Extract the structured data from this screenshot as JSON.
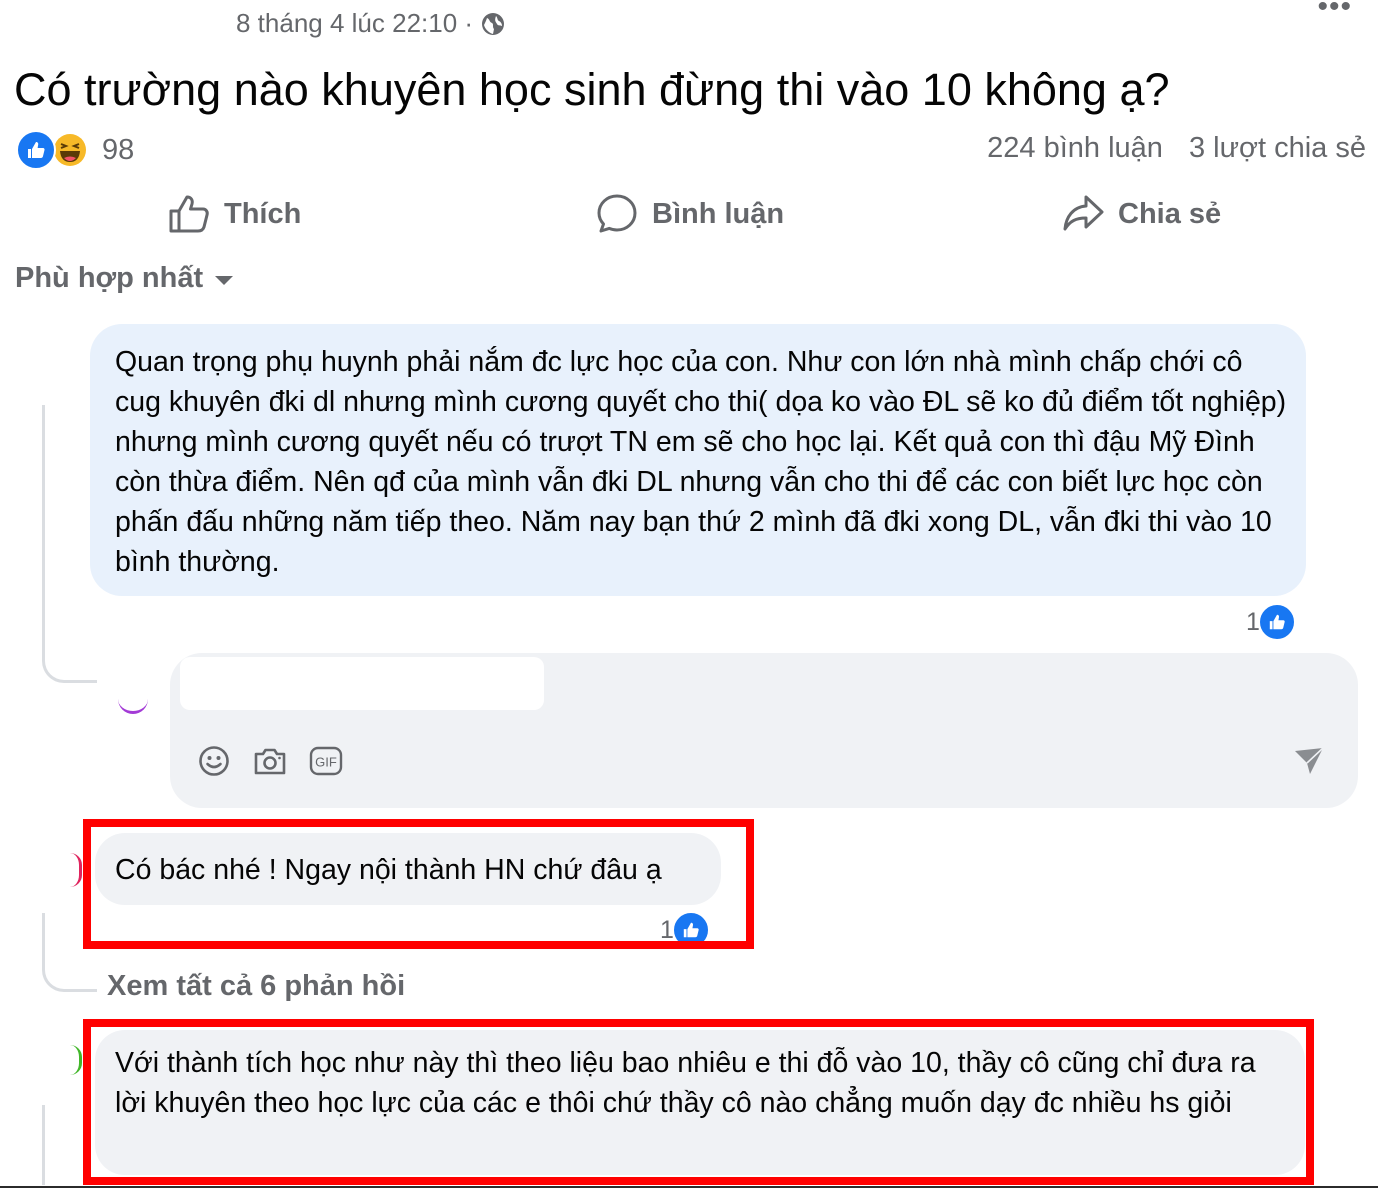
{
  "post": {
    "meta_time": "8 tháng 4 lúc 22:10 ·",
    "title": "Có trường nào khuyên học sinh đừng thi vào 10 không ạ?",
    "reaction_count": "98",
    "comment_count": "224 bình luận",
    "share_count": "3 lượt chia sẻ"
  },
  "actions": {
    "like": "Thích",
    "comment": "Bình luận",
    "share": "Chia sẻ"
  },
  "sort": {
    "label": "Phù hợp nhất"
  },
  "comments": [
    {
      "text": "Quan trọng phụ huynh phải nắm đc lực học của con. Như con lớn nhà mình chấp chới cô cug khuyên đki dl nhưng mình cương quyết cho thi( dọa ko vào ĐL sẽ ko đủ điểm tốt nghiệp) nhưng mình cương quyết nếu có trượt TN em sẽ cho học lại. Kết quả con thì đậu Mỹ Đình còn thừa điểm. Nên qđ của mình vẫn đki DL nhưng vẫn cho thi để các con biết lực học còn phấn đấu những năm tiếp theo. Năm nay bạn thứ 2 mình đã đki xong DL, vẫn đki thi vào 10 bình thường.",
      "like_count": "1"
    },
    {
      "text": "Có bác nhé ! Ngay nội thành HN chứ đâu ạ",
      "like_count": "1"
    },
    {
      "text": "Với thành tích học như này thì theo liệu bao nhiêu e thi đỗ vào 10, thầy cô cũng chỉ đưa ra lời khuyên theo học lực của các e thôi chứ thầy cô nào chẳng muốn dạy đc nhiều hs giỏi"
    }
  ],
  "replies": {
    "see_all": "Xem tất cả 6 phản hồi"
  },
  "composer": {
    "gif_label": "GIF"
  },
  "colors": {
    "accent_blue": "#1877f2",
    "highlight_bubble": "#e8f1fc",
    "gray_bubble": "#f0f2f5",
    "annotation_red": "#ff0000",
    "secondary_text": "#65676b"
  }
}
